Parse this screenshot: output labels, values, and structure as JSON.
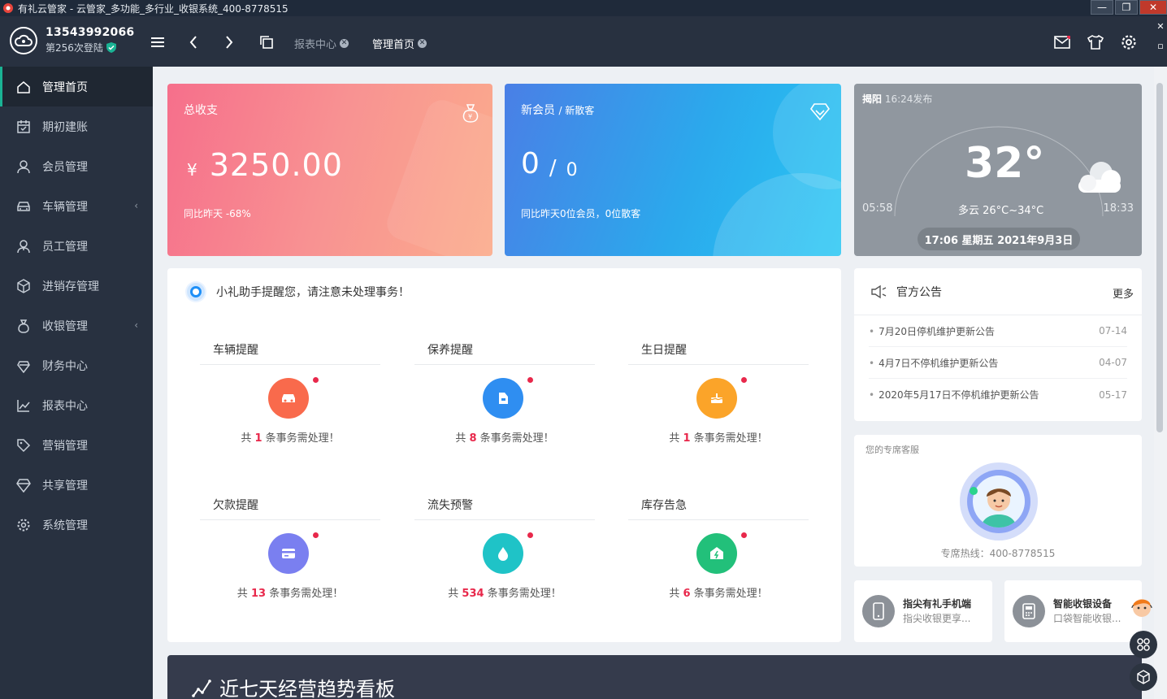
{
  "window": {
    "title": "有礼云管家 - 云管家_多功能_多行业_收银系统_400-8778515"
  },
  "header": {
    "phone": "13543992066",
    "login_text": "第256次登陆",
    "tabs": [
      {
        "label": "报表中心",
        "active": false
      },
      {
        "label": "管理首页",
        "active": true
      }
    ]
  },
  "sidebar": {
    "items": [
      {
        "label": "管理首页",
        "icon": "home-icon",
        "active": true
      },
      {
        "label": "期初建账",
        "icon": "calendar-icon"
      },
      {
        "label": "会员管理",
        "icon": "user-icon"
      },
      {
        "label": "车辆管理",
        "icon": "car-icon",
        "has_arrow": true
      },
      {
        "label": "员工管理",
        "icon": "staff-icon"
      },
      {
        "label": "进销存管理",
        "icon": "box-icon"
      },
      {
        "label": "收银管理",
        "icon": "money-bag-icon",
        "has_arrow": true
      },
      {
        "label": "财务中心",
        "icon": "finance-icon"
      },
      {
        "label": "报表中心",
        "icon": "chart-line-icon"
      },
      {
        "label": "营销管理",
        "icon": "tag-icon"
      },
      {
        "label": "共享管理",
        "icon": "diamond-icon"
      },
      {
        "label": "系统管理",
        "icon": "settings-icon"
      }
    ]
  },
  "income_card": {
    "title": "总收支",
    "currency": "¥",
    "amount": "3250.00",
    "compare": "同比昨天 -68%"
  },
  "member_card": {
    "title": "新会员",
    "title_sub": "/ 新散客",
    "members": "0",
    "separator": "/",
    "guests": "0",
    "compare": "同比昨天0位会员，0位散客"
  },
  "weather": {
    "city": "揭阳",
    "published": "16:24发布",
    "temperature": "32°",
    "desc": "多云 26°C~34°C",
    "sunrise": "05:58",
    "sunset": "18:33",
    "datetime": "17:06 星期五 2021年9月3日"
  },
  "reminders": {
    "heading": "小礼助手提醒您，请注意未处理事务！",
    "items": [
      {
        "label": "车辆提醒",
        "prefix": "共",
        "count": "1",
        "suffix": "条事务需处理！",
        "icon": "car-icon",
        "color": "#f96a4c"
      },
      {
        "label": "保养提醒",
        "prefix": "共",
        "count": "8",
        "suffix": "条事务需处理！",
        "icon": "oil-can-icon",
        "color": "#2f8ef1"
      },
      {
        "label": "生日提醒",
        "prefix": "共",
        "count": "1",
        "suffix": "条事务需处理！",
        "icon": "cake-icon",
        "color": "#fba429"
      },
      {
        "label": "欠款提醒",
        "prefix": "共",
        "count": "13",
        "suffix": "条事务需处理！",
        "icon": "card-icon",
        "color": "#7a7ff0"
      },
      {
        "label": "流失预警",
        "prefix": "共",
        "count": "534",
        "suffix": "条事务需处理！",
        "icon": "drop-icon",
        "color": "#1fc3c7"
      },
      {
        "label": "库存告急",
        "prefix": "共",
        "count": "6",
        "suffix": "条事务需处理！",
        "icon": "warehouse-icon",
        "color": "#22c07a"
      }
    ]
  },
  "notice": {
    "title": "官方公告",
    "more": "更多",
    "items": [
      {
        "text": "7月20日停机维护更新公告",
        "date": "07-14"
      },
      {
        "text": "4月7日不停机维护更新公告",
        "date": "04-07"
      },
      {
        "text": "2020年5月17日不停机维护更新公告",
        "date": "05-17"
      }
    ]
  },
  "service": {
    "label": "您的专席客服",
    "hotline": "专席热线：400-8778515"
  },
  "promos": [
    {
      "title": "指尖有礼手机端",
      "desc": "指尖收银更享..."
    },
    {
      "title": "智能收银设备",
      "desc": "口袋智能收银..."
    }
  ],
  "trend": {
    "title": "近七天经营趋势看板"
  }
}
